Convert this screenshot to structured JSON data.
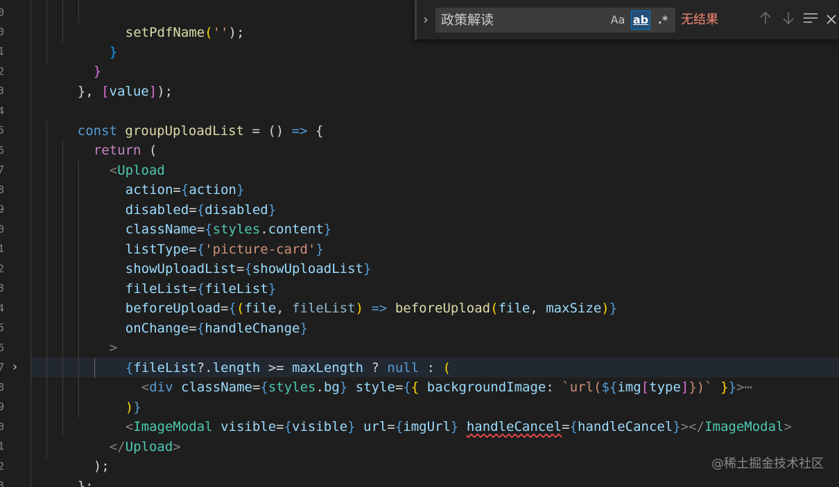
{
  "editor": {
    "line_numbers": [
      "0",
      "0",
      "1",
      "2",
      "3",
      "4",
      "5",
      "6",
      "7",
      "8",
      "9",
      "0",
      "1",
      "2",
      "3",
      "4",
      "5",
      "6",
      "7",
      "8",
      "9",
      "0",
      "1",
      "2",
      "3",
      "4"
    ],
    "code": {
      "l1_fn": "setPdfName",
      "l1_open": "(",
      "l1_str": "''",
      "l1_close": ");",
      "l2": "}",
      "l3": "}",
      "l4_a": "}, ",
      "l4_b": "[",
      "l4_c": "value",
      "l4_d": "]",
      "l4_e": ");",
      "l6_kw": "const",
      "l6_name": "groupUploadList",
      "l6_eq": " = ",
      "l6_parens": "()",
      "l6_arrow": "=>",
      "l6_brace": "{",
      "l7_kw": "return",
      "l7_paren": "(",
      "l8_lt": "<",
      "l8_tag": "Upload",
      "attr_action": "action",
      "val_action": "action",
      "attr_disabled": "disabled",
      "val_disabled": "disabled",
      "attr_className": "className",
      "val_styles": "styles",
      "val_content": "content",
      "attr_listType": "listType",
      "val_listType": "'picture-card'",
      "attr_showUploadList": "showUploadList",
      "val_showUploadList": "showUploadList",
      "attr_fileList": "fileList",
      "val_fileList": "fileList",
      "attr_beforeUpload": "beforeUpload",
      "p_file": "file",
      "p_fileList": "fileList",
      "call_beforeUpload": "beforeUpload",
      "arg_maxSize": "maxSize",
      "attr_onChange": "onChange",
      "val_handleChange": "handleChange",
      "l17_gt": ">",
      "l18_fileList": "fileList",
      "l18_length": "length",
      "l18_maxLength": "maxLength",
      "l18_null": "null",
      "l19_div": "div",
      "l19_className": "className",
      "l19_styles": "styles",
      "l19_bg": "bg",
      "l19_style": "style",
      "l19_bgImage": "backgroundImage",
      "l19_tpl_a": "`url(",
      "l19_tpl_b": "${",
      "l19_img": "img",
      "l19_type": "type",
      "l19_tpl_c": "})`",
      "l19_ellipsis": "⋯",
      "l21_tag": "ImageModal",
      "l21_visible": "visible",
      "l21_visible_val": "visible",
      "l21_url": "url",
      "l21_imgUrl": "imgUrl",
      "l21_handleCancel": "handleCancel",
      "l21_handleCancel_val": "handleCancel",
      "l21_close_tag": "ImageModal",
      "l22_tag": "Upload",
      "l23": ");",
      "l24": "};"
    }
  },
  "find_widget": {
    "query": "政策解读",
    "match_case_label": "Aa",
    "whole_word_label": "ab",
    "regex_label": ".*",
    "result_text": "无结果",
    "prev_icon": "arrow-up",
    "next_icon": "arrow-down",
    "selection_icon": "lines",
    "close_icon": "×"
  },
  "watermark": "@稀土掘金技术社区"
}
